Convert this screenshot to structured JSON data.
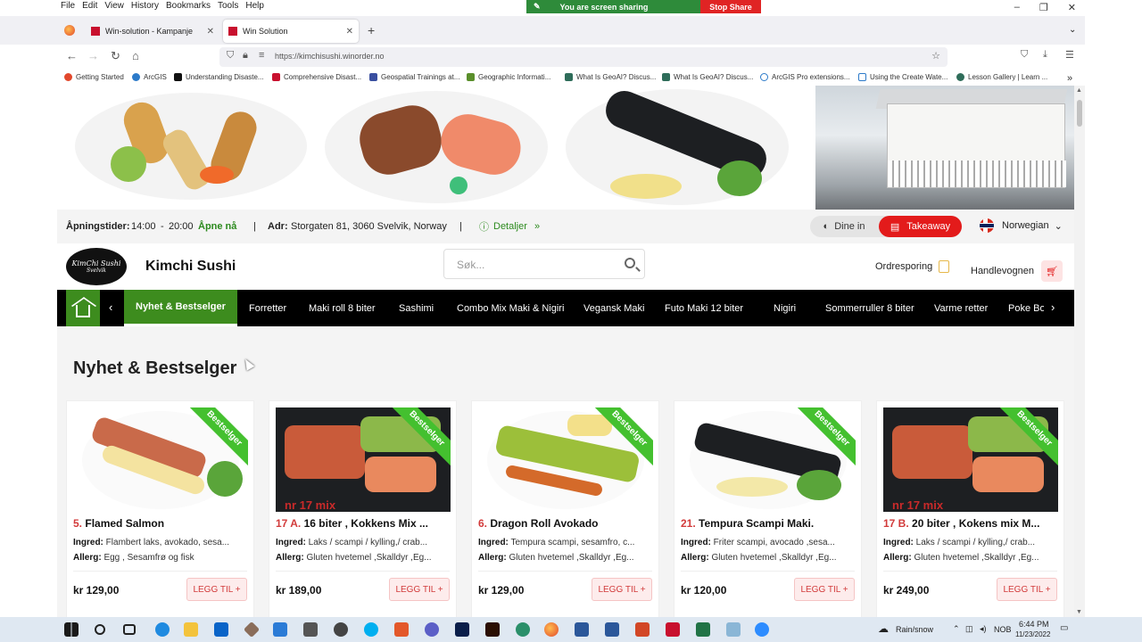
{
  "menubar": {
    "items": [
      "File",
      "Edit",
      "View",
      "History",
      "Bookmarks",
      "Tools",
      "Help"
    ]
  },
  "screen_share": {
    "status": "You are screen sharing",
    "stop_label": "Stop Share"
  },
  "tabs": [
    {
      "title": "Win-solution - Kampanje"
    },
    {
      "title": "Win Solution"
    }
  ],
  "address": {
    "url": "https://kimchisushi.winorder.no"
  },
  "bookmarks": [
    "Getting Started",
    "ArcGIS",
    "Understanding Disaste...",
    "Comprehensive Disast...",
    "Geospatial Trainings at...",
    "Geographic Informati...",
    "What Is GeoAI? Discus...",
    "What Is GeoAI? Discus...",
    "ArcGIS Pro extensions...",
    "Using the Create Wate...",
    "Lesson Gallery | Learn ..."
  ],
  "info": {
    "hours_label": "Åpningstider:",
    "hours_from": "14:00",
    "hours_dash": "-",
    "hours_to": "20:00",
    "open_status": "Åpne nå",
    "divider": "|",
    "address_label": "Adr:",
    "address": "Storgaten 81, 3060 Svelvik, Norway",
    "details": "Detaljer",
    "dine_in": "Dine in",
    "takeaway": "Takeaway",
    "language": "Norwegian"
  },
  "header": {
    "logo_line1": "KimChi Sushi",
    "logo_line2": "Svelvik",
    "brand": "Kimchi Sushi",
    "search_placeholder": "Søk...",
    "order_tracking": "Ordresporing",
    "cart": "Handlevognen"
  },
  "categories": [
    "Nyhet & Bestselger",
    "Forretter",
    "Maki roll 8 biter",
    "Sashimi",
    "Combo Mix Maki & Nigiri",
    "Vegansk Maki",
    "Futo Maki 12 biter",
    "Nigiri",
    "Sommerruller 8 biter",
    "Varme retter",
    "Poke Bo"
  ],
  "section_title": "Nyhet & Bestselger",
  "products": [
    {
      "badge": "Bestselger",
      "overlay": "",
      "num": "5.",
      "name": "Flamed Salmon",
      "ingred_label": "Ingred:",
      "ingred": "Flambert laks, avokado, sesa...",
      "allerg_label": "Allerg:",
      "allerg": "Egg , Sesamfrø og fisk",
      "price": "kr 129,00",
      "add_label": "LEGG TIL +"
    },
    {
      "badge": "Bestselger",
      "overlay": "nr 17 mix",
      "num": "17 A.",
      "name": "16 biter , Kokkens Mix ...",
      "ingred_label": "Ingred:",
      "ingred": "Laks / scampi / kylling,/ crab...",
      "allerg_label": "Allerg:",
      "allerg": "Gluten hvetemel ,Skalldyr ,Eg...",
      "price": "kr 189,00",
      "add_label": "LEGG TIL +"
    },
    {
      "badge": "Bestselger",
      "overlay": "",
      "num": "6.",
      "name": "Dragon Roll Avokado",
      "ingred_label": "Ingred:",
      "ingred": "Tempura scampi, sesamfro, c...",
      "allerg_label": "Allerg:",
      "allerg": "Gluten hvetemel ,Skalldyr ,Eg...",
      "price": "kr 129,00",
      "add_label": "LEGG TIL +"
    },
    {
      "badge": "Bestselger",
      "overlay": "",
      "num": "21.",
      "name": "Tempura Scampi Maki.",
      "ingred_label": "Ingred:",
      "ingred": "Friter scampi, avocado ,sesa...",
      "allerg_label": "Allerg:",
      "allerg": "Gluten hvetemel ,Skalldyr ,Eg...",
      "price": "kr 120,00",
      "add_label": "LEGG TIL +"
    },
    {
      "badge": "Bestselger",
      "overlay": "nr 17 mix",
      "num": "17 B.",
      "name": "20 biter , Kokens mix M...",
      "ingred_label": "Ingred:",
      "ingred": "Laks / scampi / kylling,/ crab...",
      "allerg_label": "Allerg:",
      "allerg": "Gluten hvetemel ,Skalldyr ,Eg...",
      "price": "kr 249,00",
      "add_label": "LEGG TIL +"
    }
  ],
  "taskbar": {
    "weather": "Rain/snow",
    "lang": "NOB",
    "time": "6:44 PM",
    "date": "11/23/2022"
  },
  "colors": {
    "accent_green": "#3d8c1e",
    "accent_red": "#e31b1b",
    "badge_green": "#44c02f"
  }
}
